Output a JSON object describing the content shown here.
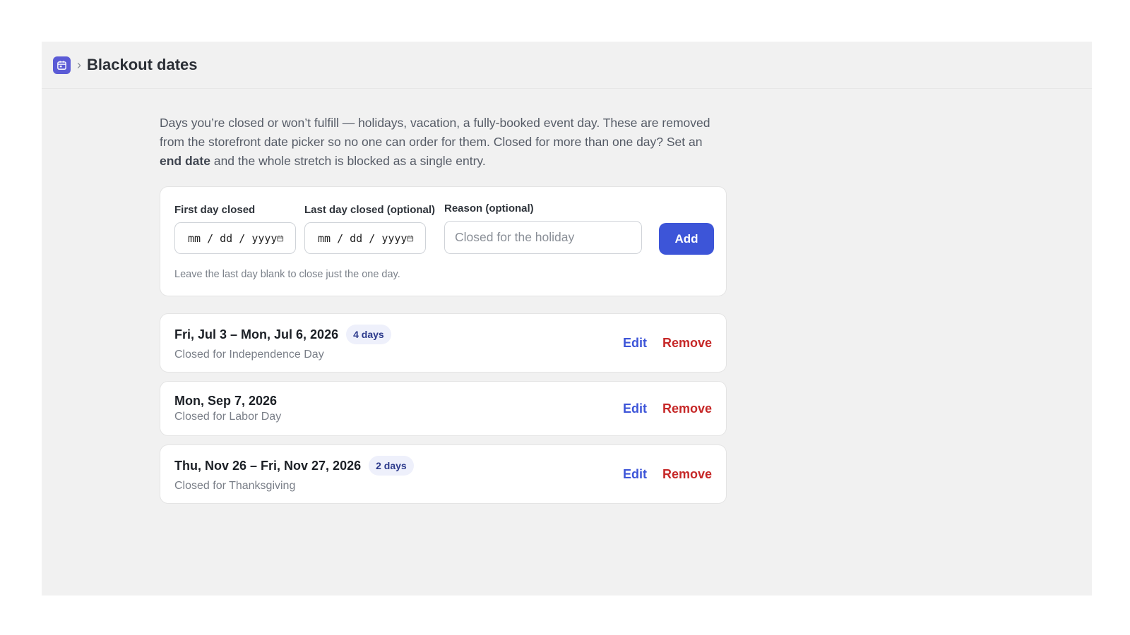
{
  "header": {
    "app_icon": "calendar-icon",
    "breadcrumb_separator": "›",
    "title": "Blackout dates"
  },
  "intro": {
    "text_before": "Days you’re closed or won’t fulfill — holidays, vacation, a fully-booked event day. These are removed from the storefront date picker so no one can order for them. Closed for more than one day? Set an ",
    "emphasis": "end date",
    "text_after": " and the whole stretch is blocked as a single entry."
  },
  "form": {
    "first_day_label": "First day closed",
    "last_day_label": "Last day closed (optional)",
    "reason_label": "Reason (optional)",
    "date_placeholder": {
      "mm": "mm",
      "dd": "dd",
      "yyyy": "yyyy",
      "sep": "/"
    },
    "reason_placeholder": "Closed for the holiday",
    "add_label": "Add",
    "hint": "Leave the last day blank to close just the one day."
  },
  "entries": [
    {
      "title": "Fri, Jul 3 – Mon, Jul 6, 2026",
      "badge": "4 days",
      "reason": "Closed for Independence Day",
      "edit": "Edit",
      "remove": "Remove"
    },
    {
      "title": "Mon, Sep 7, 2026",
      "badge": "",
      "reason": "Closed for Labor Day",
      "edit": "Edit",
      "remove": "Remove"
    },
    {
      "title": "Thu, Nov 26 – Fri, Nov 27, 2026",
      "badge": "2 days",
      "reason": "Closed for Thanksgiving",
      "edit": "Edit",
      "remove": "Remove"
    }
  ],
  "colors": {
    "accent": "#3d55d8",
    "danger": "#c62828",
    "app_icon_bg": "#5b5bd6",
    "badge_bg": "#eef0fb"
  }
}
